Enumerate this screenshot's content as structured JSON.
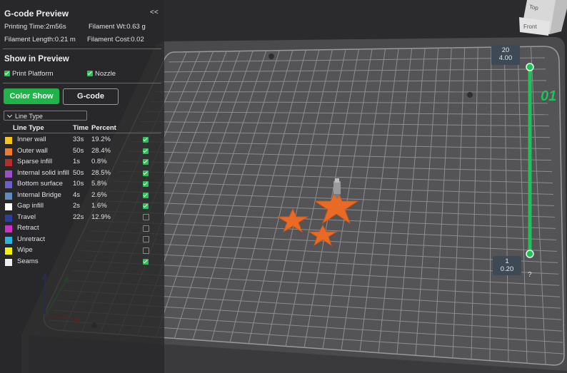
{
  "panel": {
    "title": "G-code Preview",
    "collapse_label": "<<",
    "printing_time": "Printing Time:2m56s",
    "filament_wt": "Filament Wt:0.63 g",
    "filament_length": "Filament Length:0.21 m",
    "filament_cost": "Filament Cost:0.02"
  },
  "show": {
    "title": "Show in Preview",
    "print_platform": "Print Platform",
    "nozzle": "Nozzle"
  },
  "buttons": {
    "color_show": "Color Show",
    "gcode": "G-code"
  },
  "dropdown": {
    "label": "Line Type",
    "chevron": "chevron-down-icon"
  },
  "table": {
    "headers": [
      "Line Type",
      "Time",
      "Percent"
    ],
    "rows": [
      {
        "name": "Inner wall",
        "time": "33s",
        "percent": "19.2%",
        "color": "#f5c518",
        "checked": true
      },
      {
        "name": "Outer wall",
        "time": "50s",
        "percent": "28.4%",
        "color": "#f07a2e",
        "checked": true
      },
      {
        "name": "Sparse infill",
        "time": "1s",
        "percent": "0.8%",
        "color": "#b52e2e",
        "checked": true
      },
      {
        "name": "Internal solid infill",
        "time": "50s",
        "percent": "28.5%",
        "color": "#9a4fc8",
        "checked": true
      },
      {
        "name": "Bottom surface",
        "time": "10s",
        "percent": "5.8%",
        "color": "#6e5fc4",
        "checked": true
      },
      {
        "name": "Internal Bridge",
        "time": "4s",
        "percent": "2.6%",
        "color": "#5f8cb8",
        "checked": true
      },
      {
        "name": "Gap infill",
        "time": "2s",
        "percent": "1.6%",
        "color": "#ffffff",
        "checked": true
      },
      {
        "name": "Travel",
        "time": "22s",
        "percent": "12.9%",
        "color": "#2d3f9c",
        "checked": false
      },
      {
        "name": "Retract",
        "time": "",
        "percent": "",
        "color": "#d02fc8",
        "checked": false
      },
      {
        "name": "Unretract",
        "time": "",
        "percent": "",
        "color": "#2fb2dc",
        "checked": false
      },
      {
        "name": "Wipe",
        "time": "",
        "percent": "",
        "color": "#f2f20a",
        "checked": false
      },
      {
        "name": "Seams",
        "time": "",
        "percent": "",
        "color": "#eeeeee",
        "checked": true
      }
    ]
  },
  "slider": {
    "top_layer": "20",
    "top_height": "4.00",
    "bottom_layer": "1",
    "bottom_height": "0.20",
    "layer_display": "01",
    "help": "?"
  },
  "viewcube": {
    "top": "Top",
    "front": "Front"
  },
  "colors": {
    "accent": "#21b34a",
    "slider": "#1fc158",
    "model": "#e86a25"
  }
}
